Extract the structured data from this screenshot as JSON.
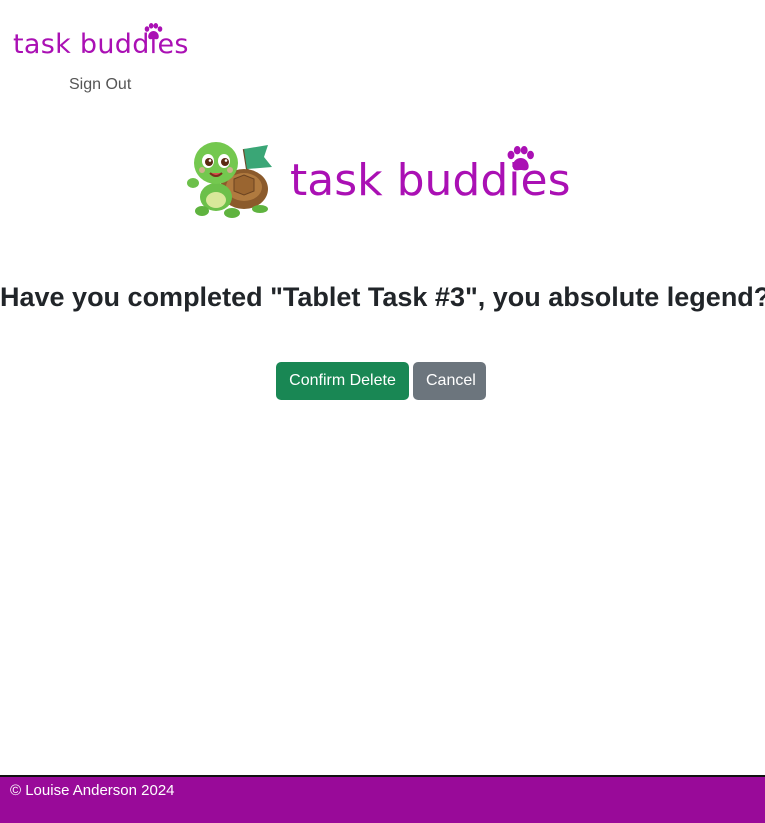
{
  "colors": {
    "brand": "#aa10b4",
    "confirm": "#198754",
    "cancel": "#6c757d",
    "footer": "#990a99"
  },
  "navbar": {
    "brand_text": "task buddies",
    "sign_out_label": "Sign Out"
  },
  "hero": {
    "logo_text": "task buddies",
    "mascot_icon": "turtle-with-flag-icon",
    "paw_icon": "paw-icon"
  },
  "main": {
    "question": "Have you completed \"Tablet Task #3\", you absolute legend?",
    "confirm_label": "Confirm Delete",
    "cancel_label": "Cancel"
  },
  "footer": {
    "copyright": "© Louise Anderson 2024"
  }
}
